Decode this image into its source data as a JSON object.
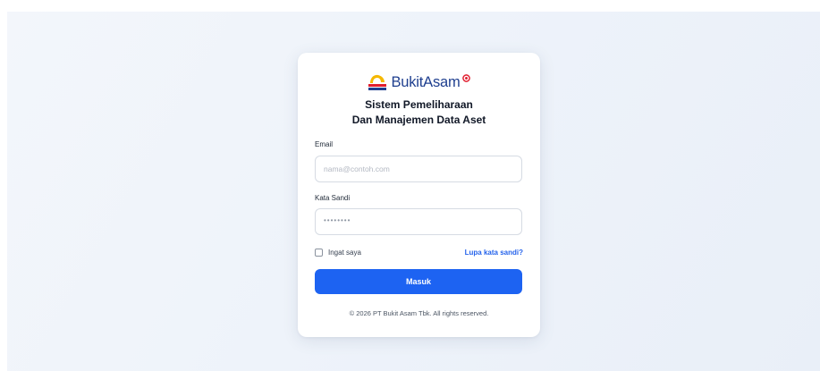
{
  "brand": {
    "name": "BukitAsam",
    "logo_icon": "bukit-asam-logo-icon",
    "colors": {
      "primary_blue": "#1f3f8f",
      "accent_red": "#e11d2e",
      "accent_yellow": "#f5b800"
    }
  },
  "title": {
    "line1": "Sistem Pemeliharaan",
    "line2": "Dan Manajemen Data Aset"
  },
  "form": {
    "email": {
      "label": "Email",
      "placeholder": "nama@contoh.com",
      "value": ""
    },
    "password": {
      "label": "Kata Sandi",
      "placeholder": "••••••••",
      "value": ""
    },
    "remember_label": "Ingat saya",
    "remember_checked": false,
    "forgot_label": "Lupa kata sandi?",
    "submit_label": "Masuk",
    "submit_color": "#1d63f2"
  },
  "footer": {
    "text": "© 2026 PT Bukit Asam Tbk. All rights reserved."
  }
}
